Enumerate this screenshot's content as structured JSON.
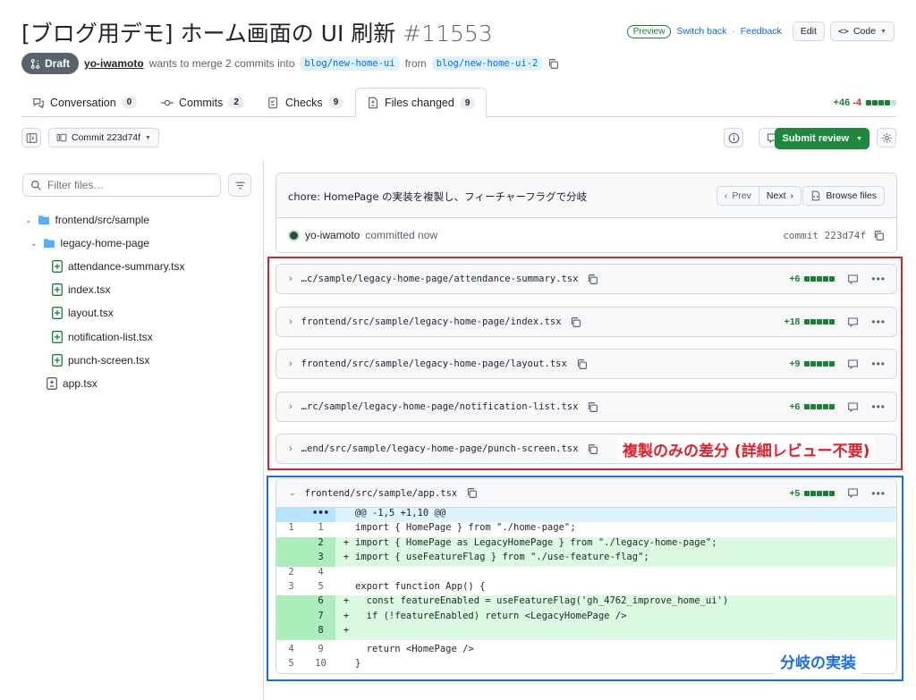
{
  "header": {
    "title": "[ブログ用デモ] ホーム画面の UI 刷新",
    "number": "#11553",
    "preview_badge": "Preview",
    "switch_back": "Switch back",
    "separator": "·",
    "feedback": "Feedback",
    "edit_label": "Edit",
    "code_label": "Code"
  },
  "pr_status": {
    "draft_label": "Draft",
    "author": "yo-iwamoto",
    "merge_text": "wants to merge 2 commits into",
    "base_branch": "blog/new-home-ui",
    "from_text": "from",
    "head_branch": "blog/new-home-ui-2"
  },
  "tabs": [
    {
      "label": "Conversation",
      "count": "0"
    },
    {
      "label": "Commits",
      "count": "2"
    },
    {
      "label": "Checks",
      "count": "9"
    },
    {
      "label": "Files changed",
      "count": "9"
    }
  ],
  "diffstat": {
    "additions": "+46",
    "deletions": "-4"
  },
  "toolbar": {
    "commit_label": "Commit 223d74f",
    "comment_count": "0",
    "submit_label": "Submit review"
  },
  "sidebar": {
    "filter_placeholder": "Filter files…",
    "tree": [
      {
        "label": "frontend/src/sample",
        "type": "folder"
      },
      {
        "label": "legacy-home-page",
        "type": "folder"
      },
      {
        "label": "attendance-summary.tsx",
        "type": "file-added"
      },
      {
        "label": "index.tsx",
        "type": "file-added"
      },
      {
        "label": "layout.tsx",
        "type": "file-added"
      },
      {
        "label": "notification-list.tsx",
        "type": "file-added"
      },
      {
        "label": "punch-screen.tsx",
        "type": "file-added"
      },
      {
        "label": "app.tsx",
        "type": "file-modified"
      }
    ]
  },
  "commit": {
    "message": "chore: HomePage の実装を複製し、フィーチャーフラグで分岐",
    "prev_label": "Prev",
    "next_label": "Next",
    "browse_label": "Browse files",
    "author": "yo-iwamoto",
    "committed_text": "committed now",
    "hash_label": "commit 223d74f"
  },
  "files": [
    {
      "path": "…c/sample/legacy-home-page/attendance-summary.tsx",
      "stat": "+6"
    },
    {
      "path": "frontend/src/sample/legacy-home-page/index.tsx",
      "stat": "+18"
    },
    {
      "path": "frontend/src/sample/legacy-home-page/layout.tsx",
      "stat": "+9"
    },
    {
      "path": "…rc/sample/legacy-home-page/notification-list.tsx",
      "stat": "+6"
    },
    {
      "path": "…end/src/sample/legacy-home-page/punch-screen.tsx",
      "stat": ""
    }
  ],
  "app_file": {
    "path": "frontend/src/sample/app.tsx",
    "stat": "+5",
    "hunk_header": "@@ -1,5 +1,10 @@",
    "expand_label": "•••",
    "lines": [
      {
        "old": "1",
        "new": "1",
        "marker": "",
        "text": "import { HomePage } from \"./home-page\";"
      },
      {
        "old": "",
        "new": "2",
        "marker": "+",
        "text": "import { HomePage as LegacyHomePage } from \"./legacy-home-page\";"
      },
      {
        "old": "",
        "new": "3",
        "marker": "+",
        "text": "import { useFeatureFlag } from \"./use-feature-flag\";"
      },
      {
        "old": "2",
        "new": "4",
        "marker": "",
        "text": ""
      },
      {
        "old": "3",
        "new": "5",
        "marker": "",
        "text": "export function App() {"
      },
      {
        "old": "",
        "new": "6",
        "marker": "+",
        "text": "  const featureEnabled = useFeatureFlag('gh_4762_improve_home_ui')"
      },
      {
        "old": "",
        "new": "7",
        "marker": "+",
        "text": "  if (!featureEnabled) return <LegacyHomePage />"
      },
      {
        "old": "",
        "new": "8",
        "marker": "+",
        "text": ""
      },
      {
        "old": "4",
        "new": "9",
        "marker": "",
        "text": "  return <HomePage />"
      },
      {
        "old": "5",
        "new": "10",
        "marker": "",
        "text": "}"
      }
    ]
  },
  "annotations": {
    "red_label": "複製のみの差分 (詳細レビュー不要)",
    "blue_label": "分岐の実装"
  },
  "colors": {
    "annotation_red": "#e0212b",
    "annotation_blue": "#1a6fdd",
    "addition_green": "#1a7f37",
    "deletion_red": "#d1242f",
    "submit_green": "#1f883d"
  }
}
